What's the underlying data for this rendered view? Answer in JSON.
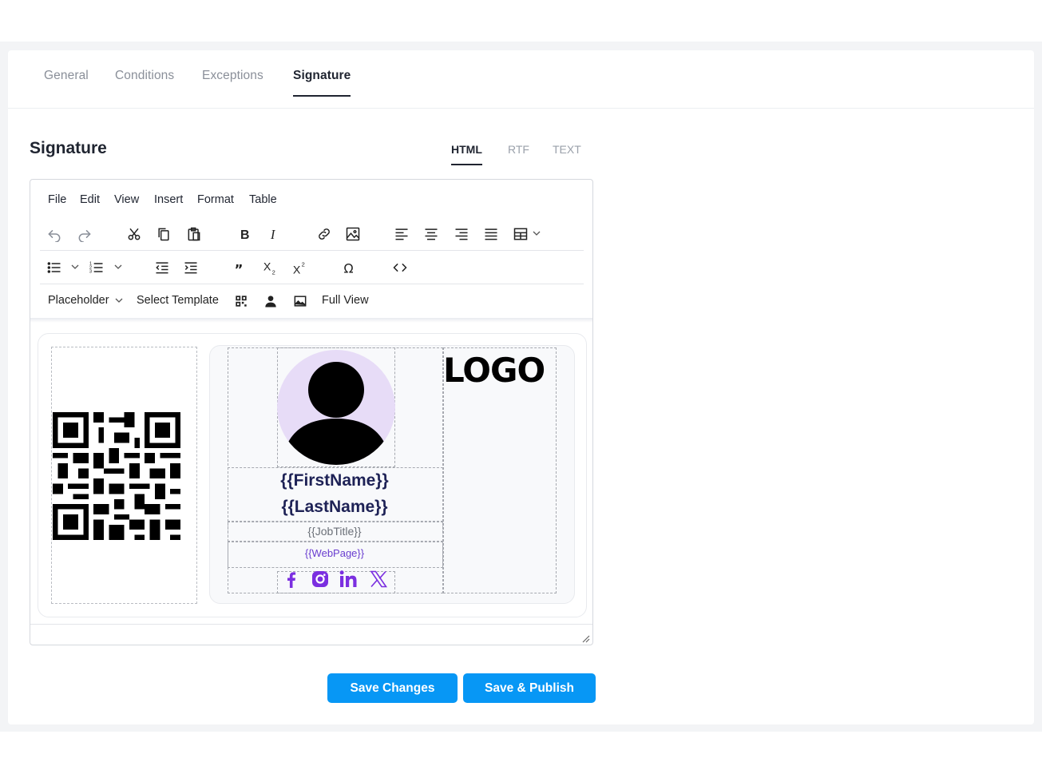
{
  "tabs": [
    "General",
    "Conditions",
    "Exceptions",
    "Signature"
  ],
  "active_tab": "Signature",
  "section_title": "Signature",
  "formats": [
    "HTML",
    "RTF",
    "TEXT"
  ],
  "active_format": "HTML",
  "menubar": [
    "File",
    "Edit",
    "View",
    "Insert",
    "Format",
    "Table"
  ],
  "toolbar3": {
    "placeholder_label": "Placeholder",
    "select_template_label": "Select Template",
    "full_view_label": "Full View"
  },
  "signature": {
    "first_name": "{{FirstName}}",
    "last_name": "{{LastName}}",
    "job_title": "{{JobTitle}}",
    "web_page": "{{WebPage}}",
    "logo_text": "LOGO",
    "social_icons": [
      "facebook-icon",
      "instagram-icon",
      "linkedin-icon",
      "x-twitter-icon"
    ]
  },
  "colors": {
    "accent": "#0797f5",
    "name_text": "#1e2256",
    "social_purple": "#7b2fe0",
    "avatar_bg": "#e7dcf7"
  },
  "actions": {
    "save_changes": "Save Changes",
    "save_publish": "Save & Publish"
  }
}
